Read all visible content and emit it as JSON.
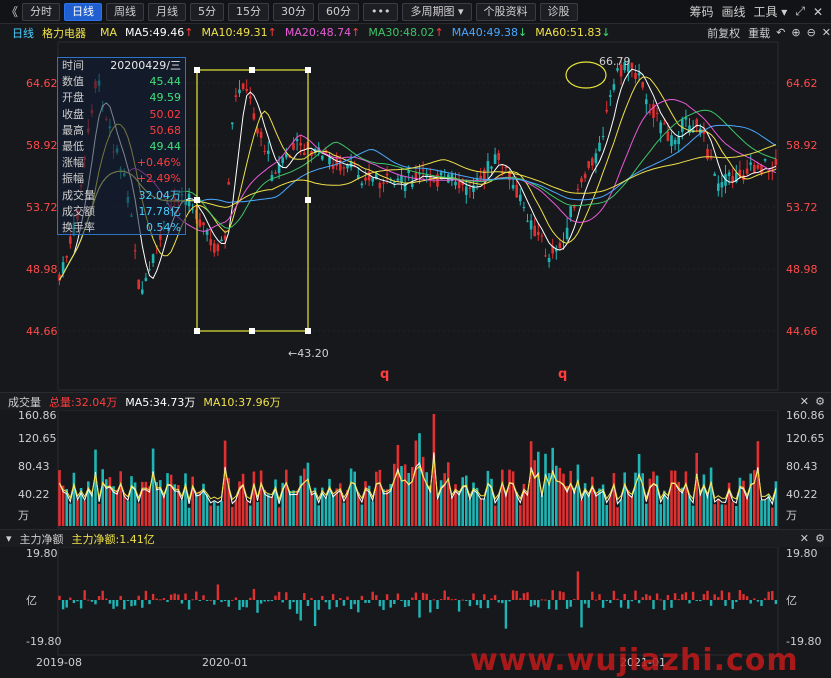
{
  "toolbar": {
    "back_icon": "double-chevron-left-icon",
    "tabs": [
      "分时",
      "日线",
      "周线",
      "月线",
      "5分",
      "15分",
      "30分",
      "60分",
      "•••",
      "多周期图 ▾",
      "个股资料",
      "诊股"
    ],
    "active_tab": "日线",
    "right": [
      "筹码",
      "画线",
      "工具 ▾"
    ],
    "expand_icon": "expand-icon",
    "close_icon": "close-icon"
  },
  "legend": {
    "period": "日线",
    "stock": "格力电器",
    "ma": "MA",
    "items": [
      {
        "label": "MA5:49.46",
        "arrow": "↑",
        "color": "#ffffff",
        "arrow_color": "#ff3d3d"
      },
      {
        "label": "MA10:49.31",
        "arrow": "↑",
        "color": "#f0e14a",
        "arrow_color": "#ff3d3d"
      },
      {
        "label": "MA20:48.74",
        "arrow": "↑",
        "color": "#e85ad8",
        "arrow_color": "#ff3d3d"
      },
      {
        "label": "MA30:48.02",
        "arrow": "↑",
        "color": "#3ec468",
        "arrow_color": "#ff3d3d"
      },
      {
        "label": "MA40:49.38",
        "arrow": "↓",
        "color": "#4aa8ff",
        "arrow_color": "#3ee07a"
      },
      {
        "label": "MA60:51.83",
        "arrow": "↓",
        "color": "#f0e14a",
        "arrow_color": "#3ee07a"
      }
    ],
    "right": [
      "前复权",
      "重载"
    ]
  },
  "price_axis": {
    "left": [
      "64.62",
      "58.92",
      "53.72",
      "48.98",
      "44.66"
    ],
    "right": [
      "64.62",
      "58.92",
      "53.72",
      "48.98",
      "44.66"
    ]
  },
  "annotations": {
    "high": "66.79",
    "low": "←43.20",
    "marker1": "q",
    "marker2": "q"
  },
  "info_box": {
    "rows": [
      {
        "k": "时间",
        "v": "20200429/三",
        "c": "#e8e8e8"
      },
      {
        "k": "数值",
        "v": "45.44",
        "c": "#3ee07a"
      },
      {
        "k": "开盘",
        "v": "49.59",
        "c": "#3ee07a"
      },
      {
        "k": "收盘",
        "v": "50.02",
        "c": "#ff3d3d"
      },
      {
        "k": "最高",
        "v": "50.68",
        "c": "#ff3d3d"
      },
      {
        "k": "最低",
        "v": "49.44",
        "c": "#3ee07a"
      },
      {
        "k": "涨幅",
        "v": "+0.46%",
        "c": "#ff3d3d"
      },
      {
        "k": "振幅",
        "v": "+2.49%",
        "c": "#ff3d3d"
      },
      {
        "k": "成交量",
        "v": "32.04万",
        "c": "#4ad0ff"
      },
      {
        "k": "成交额",
        "v": "17.78亿",
        "c": "#4ad0ff"
      },
      {
        "k": "换手率",
        "v": "0.54%",
        "c": "#4ad0ff"
      }
    ]
  },
  "volume": {
    "title": "成交量",
    "total": "总量:32.04万",
    "ma5": "MA5:34.73万",
    "ma10": "MA10:37.96万",
    "axis": [
      "160.86",
      "120.65",
      "80.43",
      "40.22",
      "万"
    ]
  },
  "flow": {
    "title": "主力净额",
    "value": "主力净额:1.41亿",
    "axis": [
      "19.80",
      "亿",
      "-19.80"
    ]
  },
  "dates": [
    "2019-08",
    "2020-01",
    "2021-01"
  ],
  "watermark": "www.wujiazhi.com",
  "colors": {
    "up": "#e03030",
    "down": "#1fb5b5",
    "accent": "#1f5fd0",
    "box": "#e6e63a"
  }
}
